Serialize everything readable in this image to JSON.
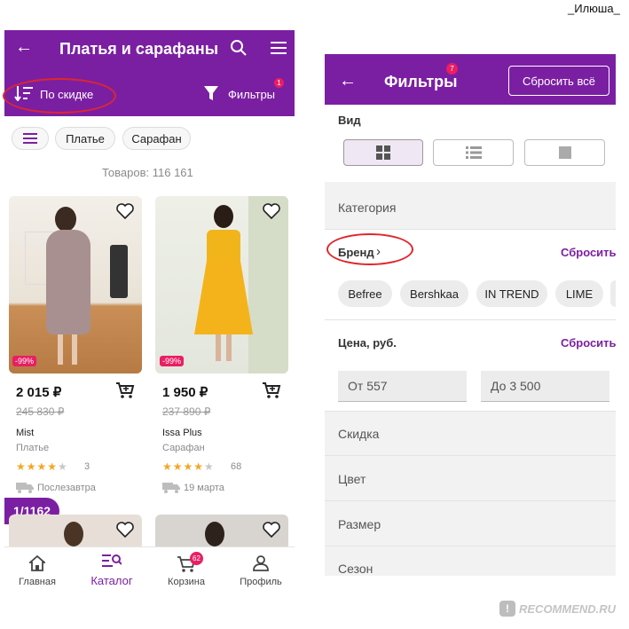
{
  "watermark_user": "_Илюша_",
  "left": {
    "header_title": "Платья и сарафаны",
    "sort_label": "По скидке",
    "filters_label": "Фильтры",
    "filters_badge": "1",
    "chips": [
      "Платье",
      "Сарафан"
    ],
    "items_count": "Товаров: 116 161",
    "products": [
      {
        "discount": "-99%",
        "price": "2 015 ₽",
        "old_price": "245 830 ₽",
        "brand": "Mist",
        "type": "Платье",
        "reviews": "3",
        "delivery": "Послезавтра",
        "rating": 4
      },
      {
        "discount": "-99%",
        "price": "1 950 ₽",
        "old_price": "237 890 ₽",
        "brand": "Issa Plus",
        "type": "Сарафан",
        "reviews": "68",
        "delivery": "19 марта",
        "rating": 4
      }
    ],
    "page_counter": "1/1162",
    "nav": {
      "home": "Главная",
      "catalog": "Каталог",
      "cart": "Корзина",
      "cart_badge": "62",
      "profile": "Профиль"
    }
  },
  "right": {
    "header_title": "Фильтры",
    "header_badge": "7",
    "reset_all": "Сбросить всё",
    "view_label": "Вид",
    "category": "Категория",
    "brand": "Бренд",
    "brand_reset": "Сбросить",
    "brands": [
      "Befree",
      "Bershkaa",
      "IN TREND",
      "LIME"
    ],
    "price_label": "Цена, руб.",
    "price_reset": "Сбросить",
    "price_from": "От 557",
    "price_to": "До 3 500",
    "rows": [
      "Скидка",
      "Цвет",
      "Размер",
      "Сезон"
    ]
  },
  "watermark_site": "RECOMMEND.RU",
  "colors": {
    "brand_purple": "#7b1fa2",
    "annotation_red": "#e0262b",
    "star": "#f5a623"
  }
}
